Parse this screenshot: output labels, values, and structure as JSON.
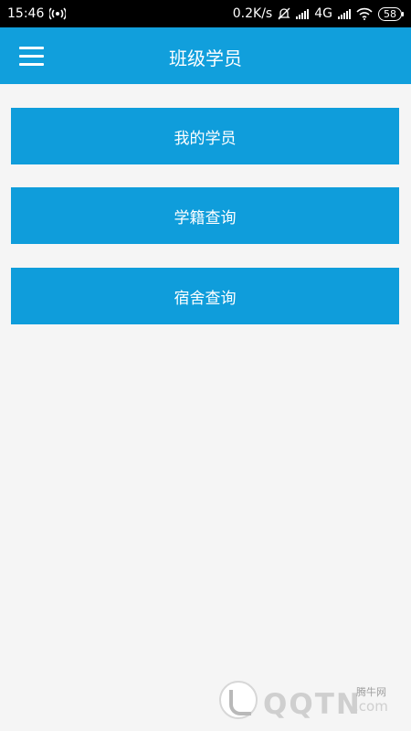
{
  "status_bar": {
    "time": "15:46",
    "network_speed": "0.2K/s",
    "network_type": "4G",
    "battery": "58"
  },
  "header": {
    "title": "班级学员"
  },
  "menu": [
    {
      "label": "我的学员"
    },
    {
      "label": "学籍查询"
    },
    {
      "label": "宿舍查询"
    }
  ],
  "watermark": {
    "site_name": "腾牛网",
    "brand": "QQTN",
    "domain": ".com"
  },
  "colors": {
    "primary": "#119fdc",
    "background": "#f5f5f5"
  }
}
